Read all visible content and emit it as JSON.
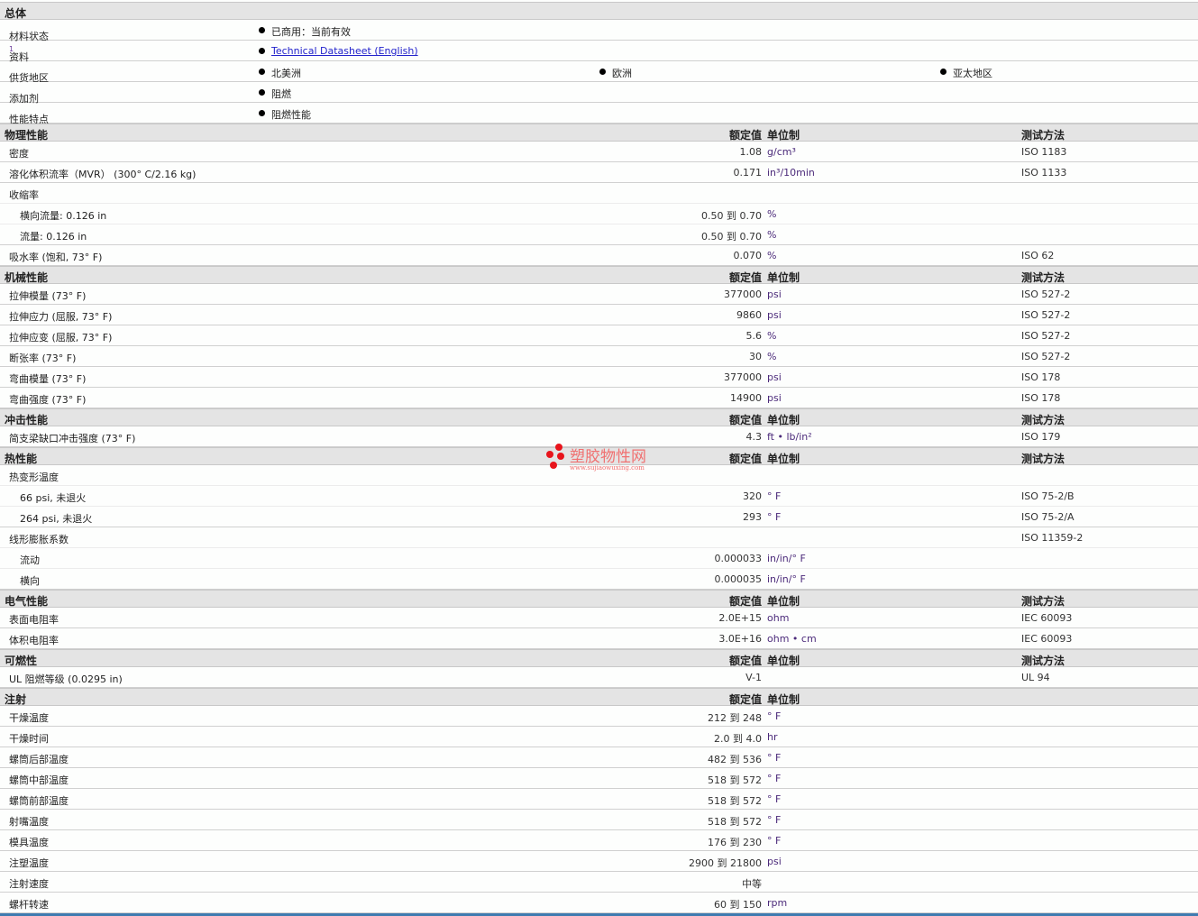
{
  "headers": {
    "value": "额定值",
    "unit": "单位制",
    "method": "测试方法"
  },
  "general": {
    "title": "总体",
    "rows": [
      {
        "label": "材料状态",
        "items": [
          "已商用：当前有效"
        ]
      },
      {
        "label": "资料",
        "sup": "1",
        "items": [
          "Technical Datasheet (English)"
        ],
        "link": true
      },
      {
        "label": "供货地区",
        "items": [
          "北美洲",
          "欧洲",
          "亚太地区"
        ]
      },
      {
        "label": "添加剂",
        "items": [
          "阻燃"
        ]
      },
      {
        "label": "性能特点",
        "items": [
          "阻燃性能"
        ]
      }
    ]
  },
  "sections": [
    {
      "title": "物理性能",
      "method_header": true,
      "rows": [
        {
          "label": "密度",
          "value": "1.08",
          "unit": "g/cm³",
          "method": "ISO 1183"
        },
        {
          "label": "溶化体积流率（MVR） (300° C/2.16 kg)",
          "value": "0.171",
          "unit": "in³/10min",
          "method": "ISO 1133"
        },
        {
          "label": "收缩率",
          "sub_next": true
        },
        {
          "label": "横向流量: 0.126 in",
          "indent": true,
          "value": "0.50 到  0.70",
          "unit": "%",
          "sub_next": true
        },
        {
          "label": "流量: 0.126 in",
          "indent": true,
          "value": "0.50 到  0.70",
          "unit": "%"
        },
        {
          "label": "吸水率 (饱和, 73° F)",
          "value": "0.070",
          "unit": "%",
          "method": "ISO 62"
        }
      ]
    },
    {
      "title": "机械性能",
      "method_header": true,
      "rows": [
        {
          "label": "拉伸模量 (73° F)",
          "value": "377000",
          "unit": "psi",
          "method": "ISO 527-2"
        },
        {
          "label": "拉伸应力 (屈服, 73° F)",
          "value": "9860",
          "unit": "psi",
          "method": "ISO 527-2"
        },
        {
          "label": "拉伸应变 (屈服, 73° F)",
          "value": "5.6",
          "unit": "%",
          "method": "ISO 527-2"
        },
        {
          "label": "断张率 (73° F)",
          "value": "30",
          "unit": "%",
          "method": "ISO 527-2"
        },
        {
          "label": "弯曲模量 (73° F)",
          "value": "377000",
          "unit": "psi",
          "method": "ISO 178"
        },
        {
          "label": "弯曲强度 (73° F)",
          "value": "14900",
          "unit": "psi",
          "method": "ISO 178"
        }
      ]
    },
    {
      "title": "冲击性能",
      "method_header": true,
      "rows": [
        {
          "label": "简支梁缺口冲击强度 (73° F)",
          "value": "4.3",
          "unit": "ft • lb/in²",
          "method": "ISO 179"
        }
      ]
    },
    {
      "title": "热性能",
      "method_header": true,
      "rows": [
        {
          "label": "热变形温度",
          "sub_next": true
        },
        {
          "label": "66 psi, 未退火",
          "indent": true,
          "value": "320",
          "unit": "° F",
          "method": "ISO 75-2/B",
          "sub_next": true
        },
        {
          "label": "264 psi, 未退火",
          "indent": true,
          "value": "293",
          "unit": "° F",
          "method": "ISO 75-2/A"
        },
        {
          "label": "线形膨胀系数",
          "method": "ISO 11359-2",
          "sub_next": true
        },
        {
          "label": "流动",
          "indent": true,
          "value": "0.000033",
          "unit": "in/in/° F",
          "sub_next": true
        },
        {
          "label": "横向",
          "indent": true,
          "value": "0.000035",
          "unit": "in/in/° F"
        }
      ]
    },
    {
      "title": "电气性能",
      "method_header": true,
      "rows": [
        {
          "label": "表面电阻率",
          "value": "2.0E+15",
          "unit": "ohm",
          "method": "IEC 60093"
        },
        {
          "label": "体积电阻率",
          "value": "3.0E+16",
          "unit": "ohm • cm",
          "method": "IEC 60093"
        }
      ]
    },
    {
      "title": "可燃性",
      "method_header": true,
      "rows": [
        {
          "label": "UL 阻燃等级 (0.0295 in)",
          "value": "V-1",
          "method": "UL 94"
        }
      ]
    },
    {
      "title": "注射",
      "method_header": false,
      "rows": [
        {
          "label": "干燥温度",
          "value": "212 到  248",
          "unit": "° F"
        },
        {
          "label": "干燥时间",
          "value": "2.0 到  4.0",
          "unit": "hr"
        },
        {
          "label": "螺筒后部温度",
          "value": "482 到  536",
          "unit": "° F"
        },
        {
          "label": "螺筒中部温度",
          "value": "518 到  572",
          "unit": "° F"
        },
        {
          "label": "螺筒前部温度",
          "value": "518 到  572",
          "unit": "° F"
        },
        {
          "label": "射嘴温度",
          "value": "518 到  572",
          "unit": "° F"
        },
        {
          "label": "模具温度",
          "value": "176 到  230",
          "unit": "° F"
        },
        {
          "label": "注塑温度",
          "value": "2900 到  21800",
          "unit": "psi"
        },
        {
          "label": "注射速度",
          "value": "中等"
        },
        {
          "label": "螺杆转速",
          "value": "60 到  150",
          "unit": "rpm"
        }
      ]
    }
  ],
  "watermark": {
    "name": "塑胶物性网",
    "url": "www.sujiaowuxing.com",
    "color": "#e8141c"
  }
}
